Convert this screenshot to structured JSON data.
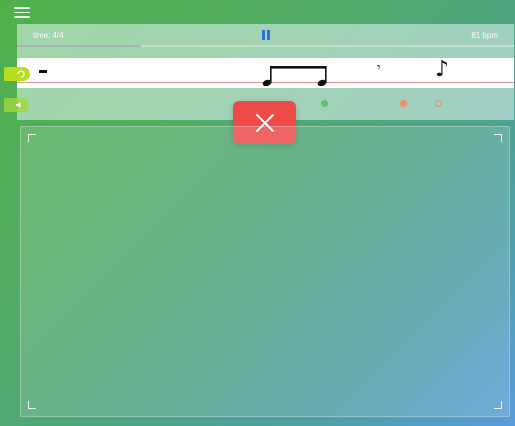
{
  "header": {
    "menu_icon": "hamburger-menu-icon"
  },
  "status": {
    "time_signature": "time: 4/4",
    "tempo": "81 bpm",
    "playback_icon": "pause-icon",
    "playback_color": "#2f6fd9",
    "progress_fraction": 0.25
  },
  "staff": {
    "symbols": [
      "whole-rest",
      "beamed-eighth-notes",
      "eighth-rest",
      "eighth-note"
    ],
    "line_color": "#d78f8f"
  },
  "indicators": {
    "dots": [
      {
        "name": "green-dot",
        "color": "#63c06a",
        "filled": true
      },
      {
        "name": "orange-dot",
        "color": "#f08f68",
        "filled": true
      },
      {
        "name": "orange-ring",
        "color": "#f08f68",
        "filled": false
      }
    ]
  },
  "side_tabs": [
    {
      "name": "loop-tab",
      "icon": "loop-icon",
      "color": "#b7dd1d"
    },
    {
      "name": "sound-tab",
      "icon": "speaker-icon",
      "color": "#a0d73c"
    }
  ],
  "overlay": {
    "close_icon": "close-icon",
    "close_color": "#ef4a4a"
  },
  "pad": {
    "corner_icon": "corner-bracket-icon"
  }
}
